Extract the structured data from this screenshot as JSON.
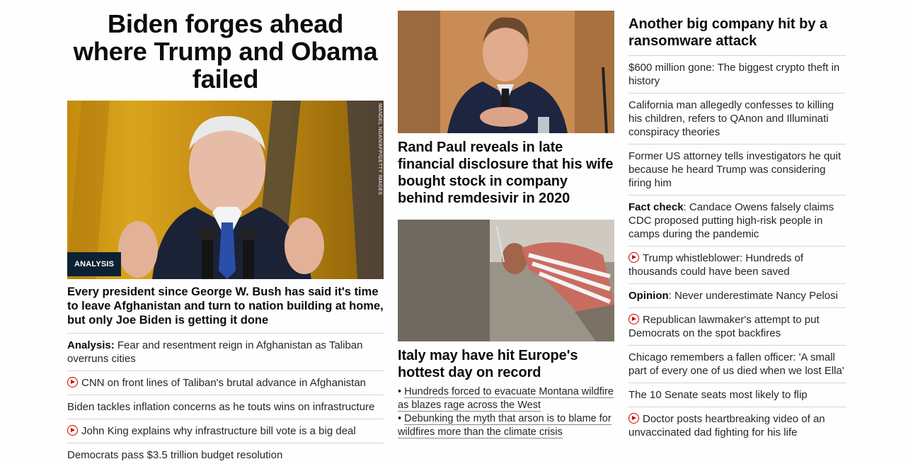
{
  "col1": {
    "headline": "Biden forges ahead where Trump and Obama failed",
    "photo_credit": "MANDEL NGAN/AFP/GETTY IMAGES",
    "badge": "ANALYSIS",
    "description": "Every president since George W. Bush has said it's time to leave Afghanistan and turn to nation building at home, but only Joe Biden is getting it done",
    "items": [
      {
        "prefix": "Analysis:",
        "text": " Fear and resentment reign in Afghanistan as Taliban overruns cities",
        "video": false
      },
      {
        "prefix": "",
        "text": "CNN on front lines of Taliban's brutal advance in Afghanistan",
        "video": true
      },
      {
        "prefix": "",
        "text": "Biden tackles inflation concerns as he touts wins on infrastructure",
        "video": false
      },
      {
        "prefix": "",
        "text": "John King explains why infrastructure bill vote is a big deal",
        "video": true
      },
      {
        "prefix": "",
        "text": "Democrats pass $3.5 trillion budget resolution",
        "video": false
      }
    ]
  },
  "col2": {
    "story1_title": "Rand Paul reveals in late financial disclosure that his wife bought stock in company behind remdesivir in 2020",
    "story2_title": "Italy may have hit Europe's hottest day on record",
    "bullets": [
      "Hundreds forced to evacuate Montana wildfire as blazes rage across the West",
      "Debunking the myth that arson is to blame for wildfires more than the climate crisis"
    ],
    "bullet_mark": "•"
  },
  "col3": {
    "top_story": "Another big company hit by a ransomware attack",
    "items": [
      {
        "prefix": "",
        "text": "$600 million gone: The biggest crypto theft in history",
        "video": false
      },
      {
        "prefix": "",
        "text": "California man allegedly confesses to killing his children, refers to QAnon and Illuminati conspiracy theories",
        "video": false
      },
      {
        "prefix": "",
        "text": "Former US attorney tells investigators he quit because he heard Trump was considering firing him",
        "video": false
      },
      {
        "prefix": "Fact check",
        "text": ": Candace Owens falsely claims CDC proposed putting high-risk people in camps during the pandemic",
        "video": false
      },
      {
        "prefix": "",
        "text": "Trump whistleblower: Hundreds of thousands could have been saved",
        "video": true
      },
      {
        "prefix": "Opinion",
        "text": ": Never underestimate Nancy Pelosi",
        "video": false
      },
      {
        "prefix": "",
        "text": "Republican lawmaker's attempt to put Democrats on the spot backfires",
        "video": true
      },
      {
        "prefix": "",
        "text": "Chicago remembers a fallen officer: 'A small part of every one of us died when we lost Ella'",
        "video": false
      },
      {
        "prefix": "",
        "text": "The 10 Senate seats most likely to flip",
        "video": false
      },
      {
        "prefix": "",
        "text": "Doctor posts heartbreaking video of an unvaccinated dad fighting for his life",
        "video": true
      }
    ]
  },
  "colors": {
    "accent_red": "#cc0000",
    "badge_bg": "#0c2233",
    "divider": "#d4d4d4"
  }
}
